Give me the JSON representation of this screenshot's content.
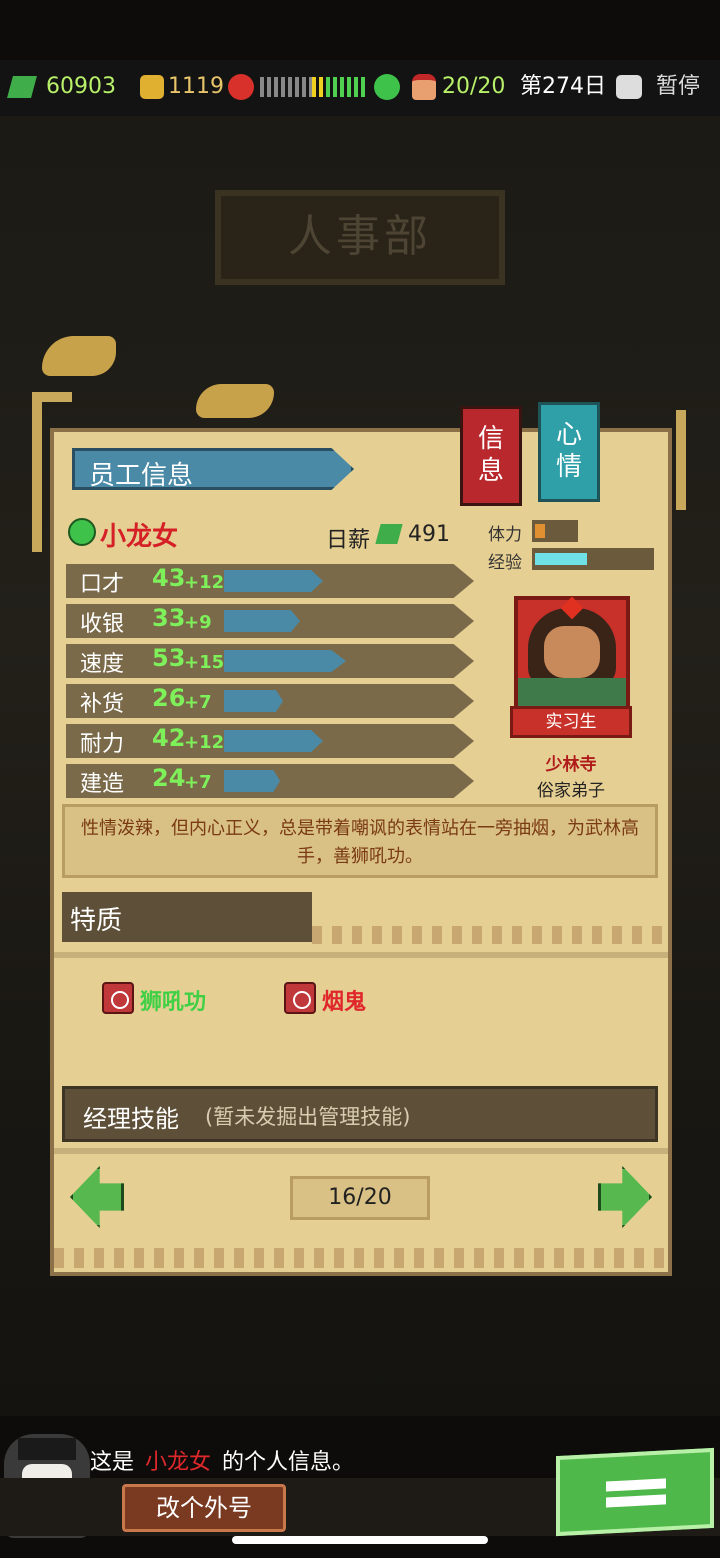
{
  "topbar": {
    "cash": "60903",
    "coins": "1119",
    "staff_count": "20/20",
    "day": "第274日",
    "pause_label": "暂停"
  },
  "department": "人事部",
  "panel": {
    "title": "员工信息",
    "tabs": [
      {
        "label": "信\n息"
      },
      {
        "label": "心\n情"
      }
    ]
  },
  "employee": {
    "name": "小龙女",
    "salary_label": "日薪",
    "salary": "491",
    "stamina_label": "体力",
    "exp_label": "经验",
    "stamina_level": 0.25,
    "exp_level": 0.45,
    "rank": "实习生",
    "faction": "少林寺",
    "faction_title": "俗家弟子",
    "stats": [
      {
        "label": "口才",
        "value": "43",
        "bonus": "+12",
        "level": 0.55
      },
      {
        "label": "收银",
        "value": "33",
        "bonus": "+9",
        "level": 0.42
      },
      {
        "label": "速度",
        "value": "53",
        "bonus": "+15",
        "level": 0.68
      },
      {
        "label": "补货",
        "value": "26",
        "bonus": "+7",
        "level": 0.33
      },
      {
        "label": "耐力",
        "value": "42",
        "bonus": "+12",
        "level": 0.55
      },
      {
        "label": "建造",
        "value": "24",
        "bonus": "+7",
        "level": 0.31
      }
    ],
    "description": "性情泼辣，但内心正义，总是带着嘲讽的表情站在一旁抽烟，为武林高手，善狮吼功。",
    "traits_title": "特质",
    "traits": [
      {
        "name": "狮吼功",
        "color": "#3fd045"
      },
      {
        "name": "烟鬼",
        "color": "#e0282c"
      }
    ],
    "manager_skill_label": "经理技能",
    "manager_skill_value": "(暂未发掘出管理技能)"
  },
  "pager": "16/20",
  "footer": {
    "message_prefix": "这是",
    "message_name": "小龙女",
    "message_suffix": "的个人信息。",
    "rename_label": "改个外号"
  },
  "colors": {
    "accent_blue": "#4a8aa6",
    "info_tab": "#b8282c",
    "mood_tab": "#2fa0a8",
    "stat_green": "#7ef05a"
  }
}
